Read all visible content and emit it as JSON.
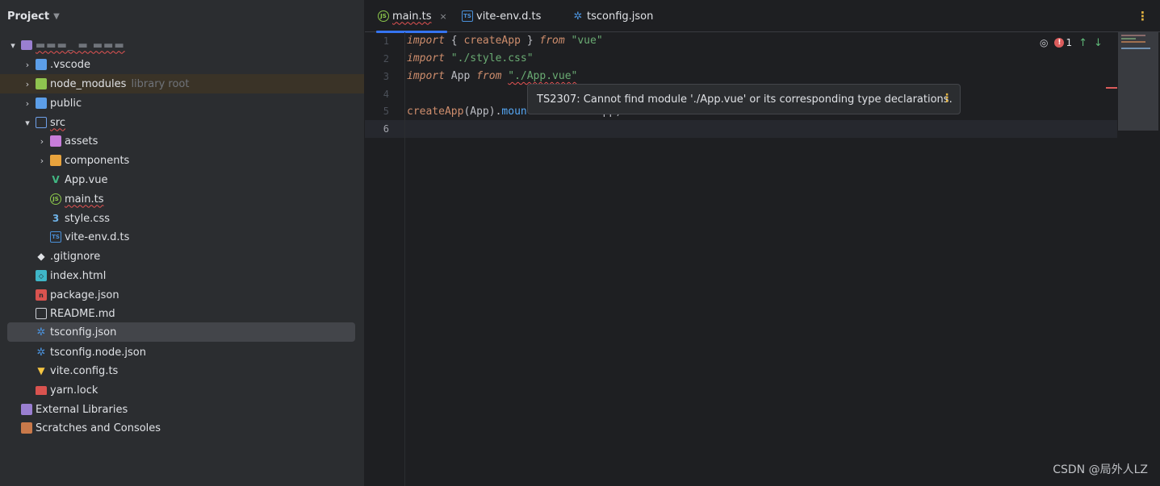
{
  "project_panel": {
    "title": "Project",
    "root_name": "▬▬▬_ ▬ ▬▬▬",
    "tree": [
      {
        "label": ".vscode",
        "icon": "folder-icon",
        "color": "#5c9ee8"
      },
      {
        "label": "node_modules",
        "suffix": "library root",
        "icon": "folder-icon",
        "color": "#8fc44f"
      },
      {
        "label": "public",
        "icon": "folder-icon",
        "color": "#5c9ee8"
      },
      {
        "label": "src",
        "icon": "folder-icon"
      },
      {
        "label": "assets",
        "icon": "folder-icon",
        "color": "#c77dda"
      },
      {
        "label": "components",
        "icon": "folder-icon",
        "color": "#e8a33d"
      },
      {
        "label": "App.vue",
        "icon": "vue-icon"
      },
      {
        "label": "main.ts",
        "icon": "nodejs-icon"
      },
      {
        "label": "style.css",
        "icon": "css-icon"
      },
      {
        "label": "vite-env.d.ts",
        "icon": "typescript-icon"
      },
      {
        "label": ".gitignore",
        "icon": "git-icon"
      },
      {
        "label": "index.html",
        "icon": "html-icon"
      },
      {
        "label": "package.json",
        "icon": "npm-icon"
      },
      {
        "label": "README.md",
        "icon": "markdown-icon"
      },
      {
        "label": "tsconfig.json",
        "icon": "tsconfig-icon"
      },
      {
        "label": "tsconfig.node.json",
        "icon": "tsconfig-icon"
      },
      {
        "label": "vite.config.ts",
        "icon": "vite-icon"
      },
      {
        "label": "yarn.lock",
        "icon": "lock-icon"
      },
      {
        "label": "External Libraries",
        "icon": "library-icon"
      },
      {
        "label": "Scratches and Consoles",
        "icon": "scratches-icon"
      }
    ]
  },
  "editor": {
    "tabs": [
      {
        "label": "main.ts",
        "icon": "nodejs-icon"
      },
      {
        "label": "vite-env.d.ts",
        "icon": "typescript-icon"
      },
      {
        "label": "tsconfig.json",
        "icon": "tsconfig-icon"
      }
    ],
    "close_glyph": "×",
    "line_numbers": [
      "1",
      "2",
      "3",
      "4",
      "5",
      "6"
    ],
    "code": {
      "l1": {
        "kw1": "import",
        "t1": " { ",
        "fn": "createApp",
        "t2": " } ",
        "kw2": "from",
        "str": " \"vue\""
      },
      "l2": {
        "kw1": "import",
        "str": " \"./style.css\""
      },
      "l3": {
        "kw1": "import",
        "t1": " App ",
        "kw2": "from",
        "str": "\"./App.vue\""
      },
      "l5": {
        "fn": "createApp",
        "t1": "(App).",
        "fn2": "moun",
        "t2": "           ",
        "t3": "App)"
      }
    },
    "error_count": "1",
    "tooltip": "TS2307: Cannot find module './App.vue' or its corresponding type declarations.",
    "colors": {
      "accent": "#3574f0",
      "error": "#db5c5c",
      "keyword": "#cf8e6d",
      "string": "#6aab73",
      "function": "#56a8f5"
    }
  },
  "watermark": "CSDN @局外人LZ"
}
